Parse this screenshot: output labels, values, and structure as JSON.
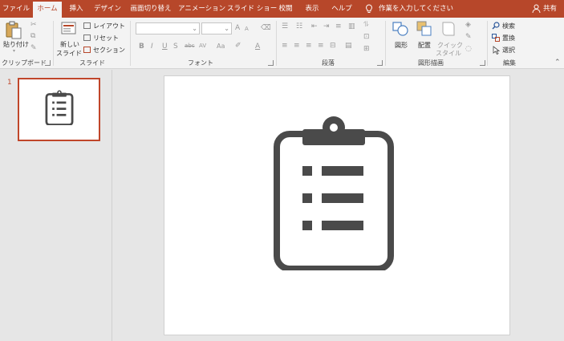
{
  "tabs": [
    {
      "label": "ファイル"
    },
    {
      "label": "ホーム"
    },
    {
      "label": "挿入"
    },
    {
      "label": "デザイン"
    },
    {
      "label": "画面切り替え"
    },
    {
      "label": "アニメーション"
    },
    {
      "label": "スライド ショー"
    },
    {
      "label": "校閲"
    },
    {
      "label": "表示"
    },
    {
      "label": "ヘルプ"
    }
  ],
  "active_tab": "ホーム",
  "tell_me": "作業を入力してください",
  "share": "共有",
  "clipboard": {
    "paste": "貼り付け",
    "group": "クリップボード"
  },
  "slides": {
    "new_slide_1": "新しい",
    "new_slide_2": "スライド",
    "layout": "レイアウト",
    "reset": "リセット",
    "section": "セクション",
    "group": "スライド"
  },
  "font": {
    "group": "フォント",
    "grow": "A",
    "shrink": "A",
    "bold": "B",
    "italic": "I",
    "underline": "U",
    "strike": "S",
    "abc": "abc",
    "spacing": "AV",
    "case": "Aa",
    "color": "A"
  },
  "paragraph": {
    "group": "段落"
  },
  "drawing": {
    "shapes": "図形",
    "arrange": "配置",
    "quick_style_1": "クイック",
    "quick_style_2": "スタイル",
    "group": "図形描画"
  },
  "editing": {
    "find": "検索",
    "replace": "置換",
    "select": "選択",
    "group": "編集"
  },
  "slide_panel": {
    "slide_number": "1",
    "selected_slide": 1
  },
  "colors": {
    "accent": "#b7472a",
    "icon": "#4a4a4a",
    "ribbon": "#f3f3f3",
    "workspace": "#e6e6e6"
  },
  "icons": [
    "clipboard-list-icon",
    "lightbulb-icon",
    "person-icon",
    "magnifier-icon",
    "replace-icon",
    "cursor-icon"
  ]
}
